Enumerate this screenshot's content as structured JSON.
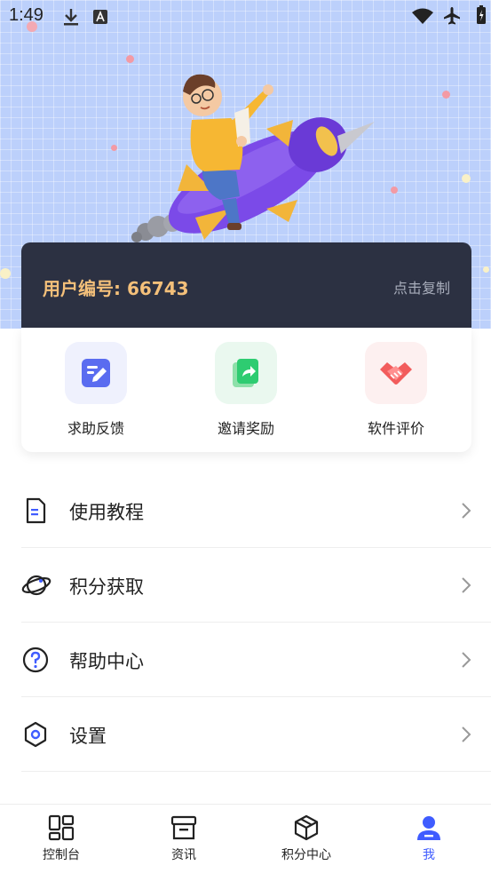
{
  "status_bar": {
    "time": "1:49"
  },
  "user_card": {
    "user_id_text": "用户编号: 66743",
    "copy_label": "点击复制"
  },
  "quick_actions": [
    {
      "label": "求助反馈",
      "icon": "edit-note-icon"
    },
    {
      "label": "邀请奖励",
      "icon": "share-icon"
    },
    {
      "label": "软件评价",
      "icon": "handshake-icon"
    }
  ],
  "menu": [
    {
      "label": "使用教程",
      "icon": "document-icon"
    },
    {
      "label": "积分获取",
      "icon": "planet-icon"
    },
    {
      "label": "帮助中心",
      "icon": "question-icon"
    },
    {
      "label": "设置",
      "icon": "settings-icon"
    }
  ],
  "tabbar": [
    {
      "label": "控制台",
      "icon": "dashboard-icon",
      "active": false
    },
    {
      "label": "资讯",
      "icon": "news-icon",
      "active": false
    },
    {
      "label": "积分中心",
      "icon": "box-icon",
      "active": false
    },
    {
      "label": "我",
      "icon": "profile-icon",
      "active": true
    }
  ],
  "colors": {
    "accent": "#3f5cff",
    "card_dark": "#2c3142",
    "user_id_gold": "#f4c07a",
    "hero_bg": "#bcd0fb"
  }
}
